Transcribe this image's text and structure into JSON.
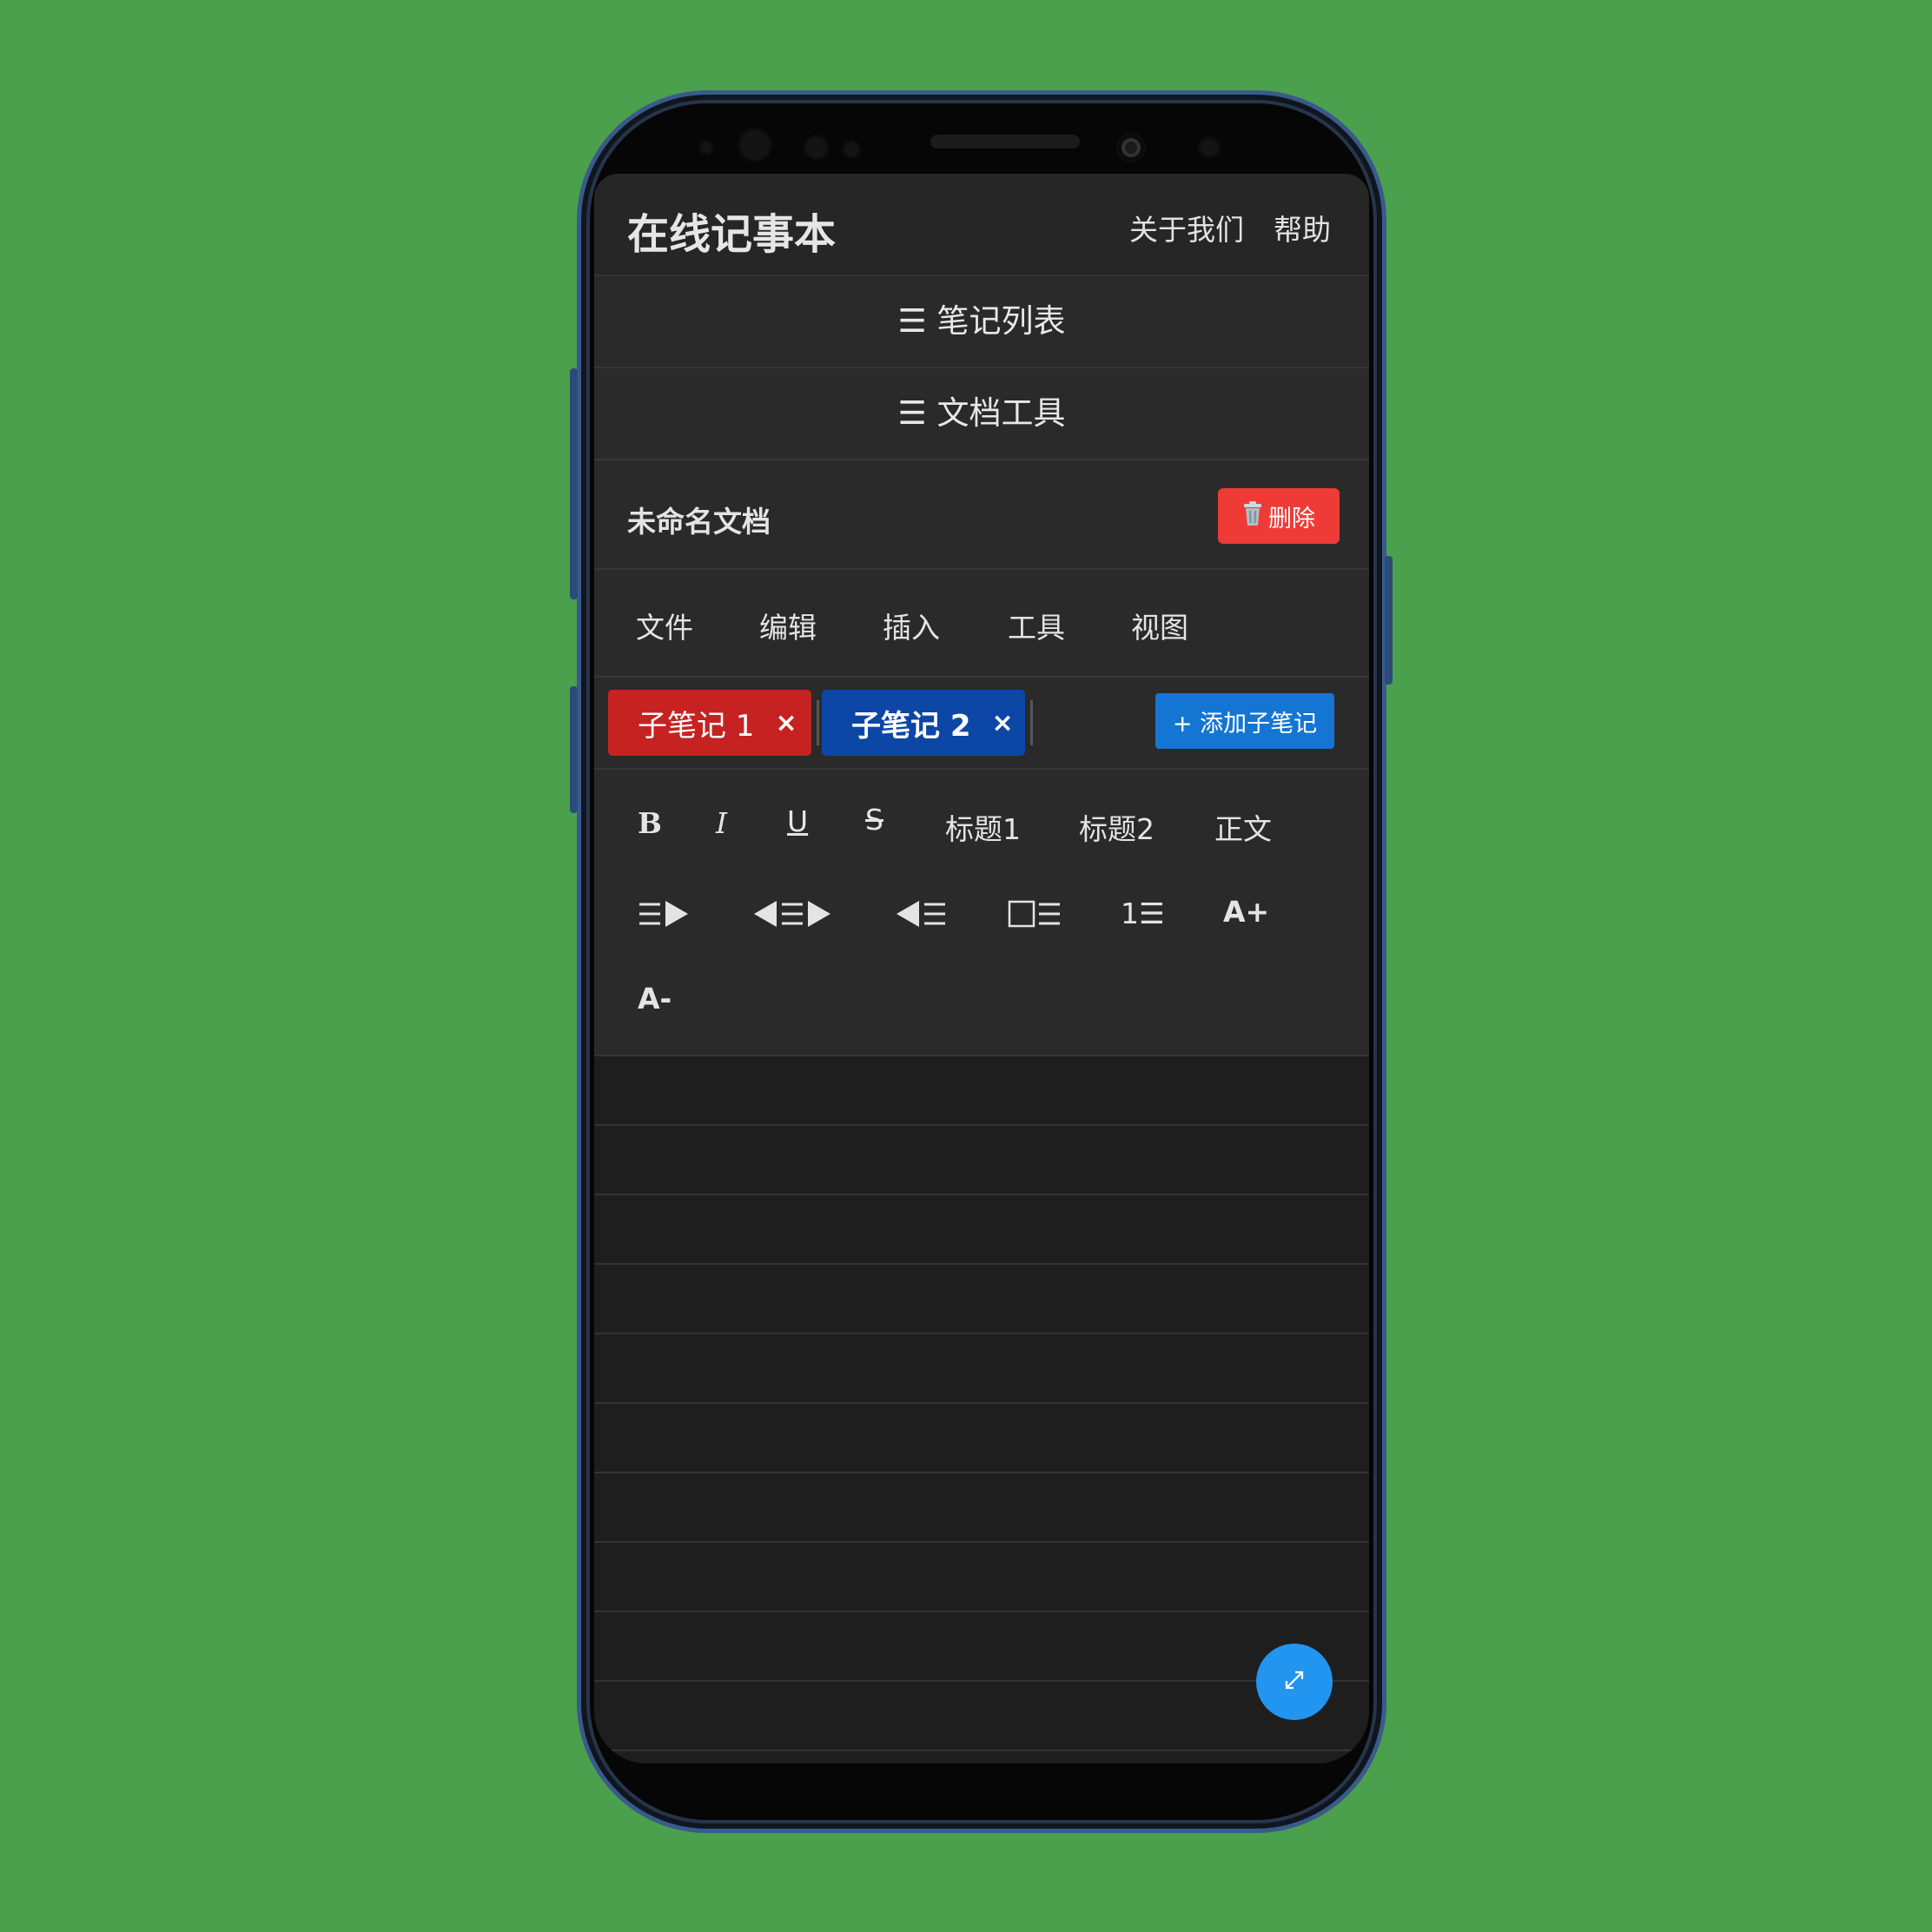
{
  "header": {
    "title": "在线记事本",
    "nav": [
      "关于我们",
      "帮助"
    ]
  },
  "panels": {
    "note_list": "☰ 笔记列表",
    "doc_tools": "☰ 文档工具"
  },
  "document": {
    "title": "未命名文档",
    "delete_label": "删除",
    "delete_icon": "trash-icon"
  },
  "menu": [
    "文件",
    "编辑",
    "插入",
    "工具",
    "视图"
  ],
  "tabs": [
    {
      "label": "子笔记 1",
      "close": "×",
      "color": "#c62221"
    },
    {
      "label": "子笔记 2",
      "close": "×",
      "color": "#0d47a6"
    }
  ],
  "add_subnote": "+ 添加子笔记",
  "toolbar": {
    "bold": "B",
    "italic": "I",
    "underline": "U",
    "strike": "S",
    "heading1": "标题1",
    "heading2": "标题2",
    "body": "正文",
    "numbered_list_glyph": "1☰",
    "font_increase": "A+",
    "font_decrease": "A-"
  },
  "colors": {
    "background": "#4aa04c",
    "accent": "#2195f0",
    "danger": "#ef3b36",
    "add_button": "#1476d2"
  },
  "fab_icon": "expand-icon"
}
